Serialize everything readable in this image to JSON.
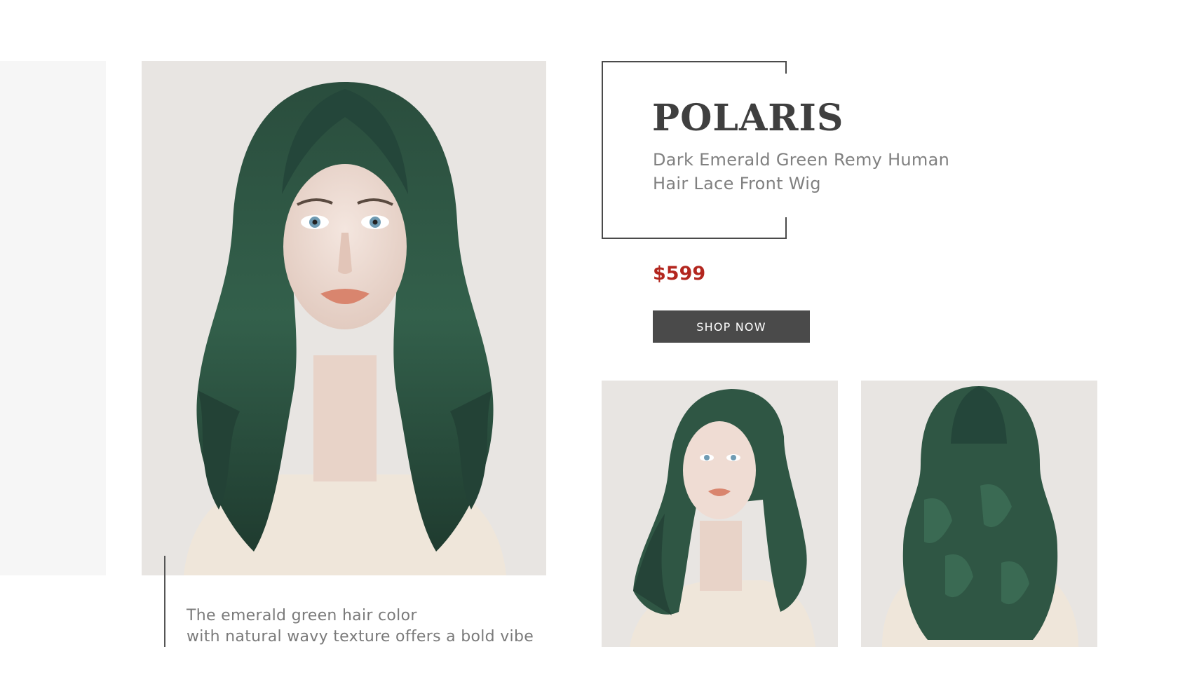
{
  "product": {
    "name": "POLARIS",
    "subtitle_lines": [
      "Dark Emerald Green Remy Human",
      "Hair Lace Front Wig"
    ],
    "price": "$599",
    "cta_label": "SHOP NOW",
    "description_lines": [
      "The emerald green hair color",
      "with natural wavy texture offers a bold vibe"
    ]
  },
  "colors": {
    "accent_price": "#b3261e",
    "button_bg": "#4a4a4a",
    "hair": "#2f5644",
    "photo_bg": "#e8e5e2"
  }
}
